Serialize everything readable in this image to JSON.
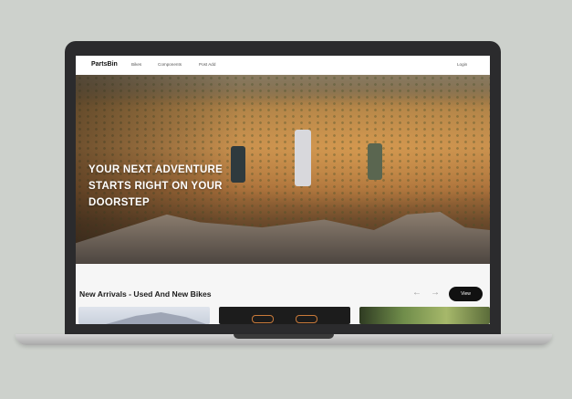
{
  "navbar": {
    "brand": "PartsBin",
    "links": [
      "Bikes",
      "Components",
      "Post Add"
    ],
    "login": "Login"
  },
  "hero": {
    "title": "YOUR NEXT ADVENTURE STARTS RIGHT ON YOUR DOORSTEP"
  },
  "section": {
    "title": "New Arrivals - Used And New Bikes",
    "prev_icon": "←",
    "next_icon": "→",
    "view_label": "View"
  },
  "colors": {
    "page_background": "#cdd1cc",
    "laptop_frame": "#2b2b2d",
    "view_button": "#111111"
  },
  "icons": [
    "arrow-left-icon",
    "arrow-right-icon"
  ]
}
